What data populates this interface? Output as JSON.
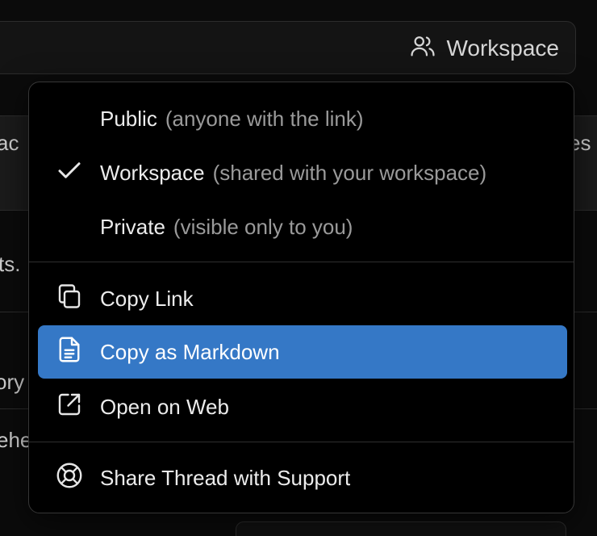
{
  "header": {
    "workspace_label": "Workspace"
  },
  "background": {
    "frag_1": "ac",
    "frag_2": "es",
    "frag_3": "ts.",
    "frag_4": "ory",
    "frag_5": "ehe"
  },
  "menu": {
    "visibility": [
      {
        "label": "Public",
        "hint": "(anyone with the link)",
        "checked": false
      },
      {
        "label": "Workspace",
        "hint": "(shared with your workspace)",
        "checked": true
      },
      {
        "label": "Private",
        "hint": "(visible only to you)",
        "checked": false
      }
    ],
    "actions": [
      {
        "label": "Copy Link",
        "icon": "copy-icon"
      },
      {
        "label": "Copy as Markdown",
        "icon": "document-icon",
        "highlighted": true
      },
      {
        "label": "Open on Web",
        "icon": "external-link-icon"
      }
    ],
    "support": {
      "label": "Share Thread with Support",
      "icon": "lifebuoy-icon"
    }
  },
  "colors": {
    "highlight": "#3578c6",
    "menu_bg": "#000000",
    "hint_text": "#9a9a9a"
  }
}
